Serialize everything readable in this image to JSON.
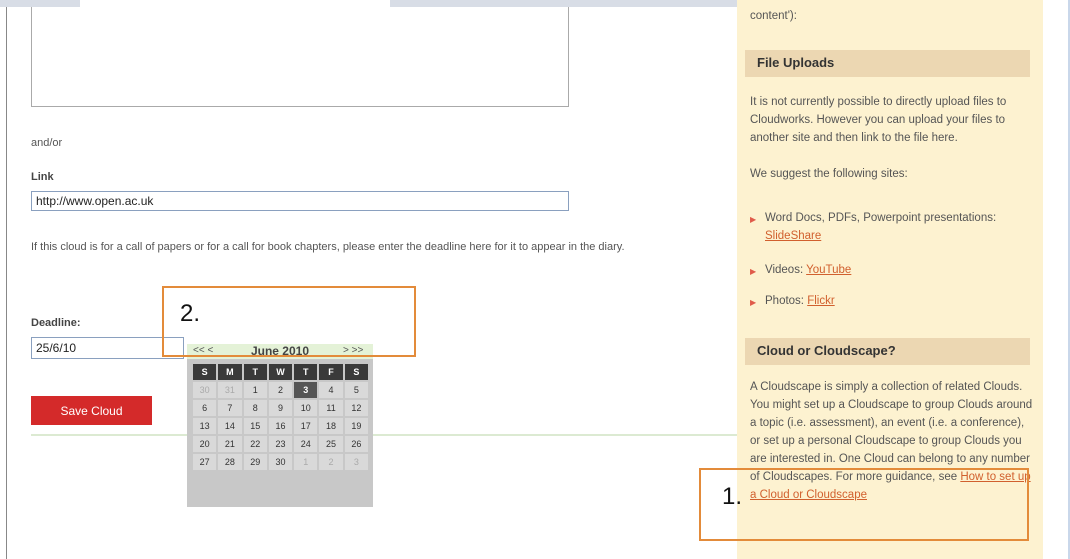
{
  "form": {
    "and_or": "and/or",
    "link_label": "Link",
    "link_value": "http://www.open.ac.uk",
    "deadline_info": "If this cloud is for a call of papers or for a call for book chapters, please enter the deadline here for it to appear in the diary.",
    "deadline_label": "Deadline:",
    "deadline_value": "25/6/10",
    "save_label": "Save Cloud"
  },
  "calendar": {
    "prev": "<< <",
    "title": "June 2010",
    "next": "> >>",
    "weekdays": [
      "S",
      "M",
      "T",
      "W",
      "T",
      "F",
      "S"
    ],
    "weeks": [
      [
        "30",
        "31",
        "1",
        "2",
        "3",
        "4",
        "5"
      ],
      [
        "6",
        "7",
        "8",
        "9",
        "10",
        "11",
        "12"
      ],
      [
        "13",
        "14",
        "15",
        "16",
        "17",
        "18",
        "19"
      ],
      [
        "20",
        "21",
        "22",
        "23",
        "24",
        "25",
        "26"
      ],
      [
        "27",
        "28",
        "29",
        "30",
        "1",
        "2",
        "3"
      ]
    ],
    "selected_day": "3"
  },
  "annotations": {
    "one": "1.",
    "two": "2."
  },
  "sidebar": {
    "content_tail": "content'):",
    "file_uploads_heading": "File Uploads",
    "file_uploads_text": "It is not currently possible to directly upload files to Cloudworks. However you can upload your files to another site and then link to the file here.",
    "suggest_text": "We suggest the following sites:",
    "items": [
      {
        "prefix": "Word Docs, PDFs, Powerpoint presentations: ",
        "link": "SlideShare"
      },
      {
        "prefix": "Videos: ",
        "link": "YouTube"
      },
      {
        "prefix": "Photos: ",
        "link": "Flickr"
      }
    ],
    "cloudscape_heading": "Cloud or Cloudscape?",
    "cloudscape_text": "A Cloudscape is simply a collection of related Clouds. You might set up a Cloudscape to group Clouds around a topic (i.e. assessment), an event (i.e. a conference), or set up a personal Cloudscape to group Clouds you are interested in. One Cloud can belong to any number of Cloudscapes. For more guidance, see ",
    "cloudscape_link": "How to set up a Cloud or Cloudscape"
  },
  "colors": {
    "save_button": "#d42a2a",
    "sidebar_bg": "#fdf2d0",
    "heading_bg": "#ecd7b2",
    "annotation": "#e38b3a"
  }
}
